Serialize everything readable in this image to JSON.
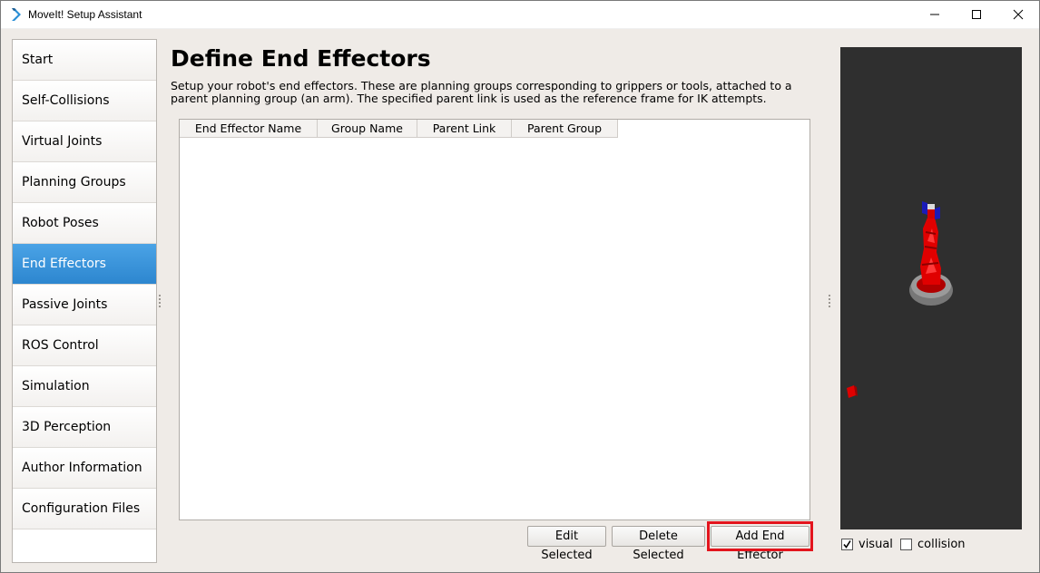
{
  "window": {
    "title": "MoveIt! Setup Assistant",
    "controls": [
      "minimize-icon",
      "maximize-icon",
      "close-icon"
    ]
  },
  "sidebar": {
    "items": [
      {
        "label": "Start"
      },
      {
        "label": "Self-Collisions"
      },
      {
        "label": "Virtual Joints"
      },
      {
        "label": "Planning Groups"
      },
      {
        "label": "Robot Poses"
      },
      {
        "label": "End Effectors",
        "active": true
      },
      {
        "label": "Passive Joints"
      },
      {
        "label": "ROS Control"
      },
      {
        "label": "Simulation"
      },
      {
        "label": "3D Perception"
      },
      {
        "label": "Author Information"
      },
      {
        "label": "Configuration Files"
      }
    ]
  },
  "main": {
    "title": "Define End Effectors",
    "description": "Setup your robot's end effectors. These are planning groups corresponding to grippers or tools, attached to a parent planning group (an arm). The specified parent link is used as the reference frame for IK attempts.",
    "table": {
      "columns": [
        "End Effector Name",
        "Group Name",
        "Parent Link",
        "Parent Group"
      ],
      "rows": []
    },
    "buttons": {
      "edit_label": "Edit Selected",
      "delete_label": "Delete Selected",
      "add_label": "Add End Effector"
    }
  },
  "viewer": {
    "visual_label": "visual",
    "visual_checked": true,
    "collision_label": "collision",
    "collision_checked": false
  },
  "colors": {
    "active_nav": "#3595db",
    "highlight": "#e3141d",
    "viewport_bg": "#2f2f2f",
    "robot": "#e00000"
  }
}
